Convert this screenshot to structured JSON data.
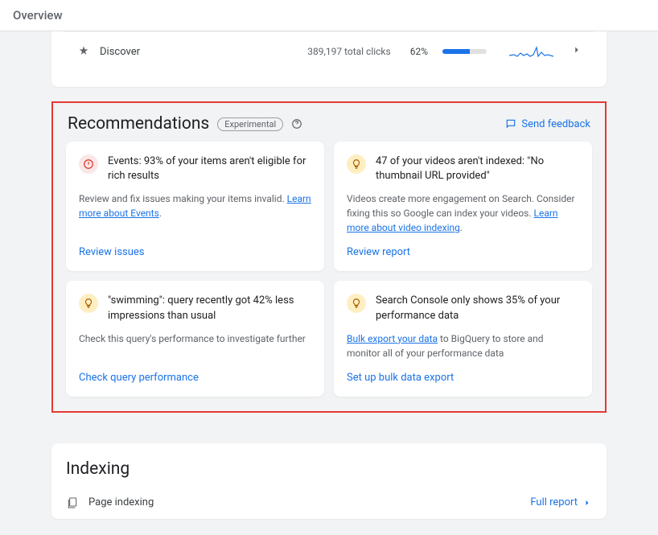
{
  "header": {
    "title": "Overview"
  },
  "discover": {
    "label": "Discover",
    "clicks": "389,197 total clicks",
    "pct": "62%"
  },
  "recommendations": {
    "title": "Recommendations",
    "badge": "Experimental",
    "feedback": "Send feedback",
    "cards": [
      {
        "icon": "warn",
        "title": "Events: 93% of your items aren't eligible for rich results",
        "body_pre": "Review and fix issues making your items invalid. ",
        "link": "Learn more about Events",
        "body_post": ".",
        "action": "Review issues"
      },
      {
        "icon": "tip",
        "title": "47 of your videos aren't indexed: \"No thumbnail URL provided\"",
        "body_pre": "Videos create more engagement on Search. Consider fixing this so Google can index your videos. ",
        "link": "Learn more about video indexing",
        "body_post": ".",
        "action": "Review report"
      },
      {
        "icon": "tip",
        "title": "\"swimming\": query recently got 42% less impressions than usual",
        "body_pre": "Check this query's performance to investigate further",
        "link": "",
        "body_post": "",
        "action": "Check query performance"
      },
      {
        "icon": "tip",
        "title": "Search Console only shows 35% of your performance data",
        "body_pre": "",
        "link": "Bulk export your data",
        "body_post": " to BigQuery to store and monitor all of your performance data",
        "action": "Set up bulk data export"
      }
    ]
  },
  "indexing": {
    "title": "Indexing",
    "row_label": "Page indexing",
    "full_report": "Full report"
  }
}
